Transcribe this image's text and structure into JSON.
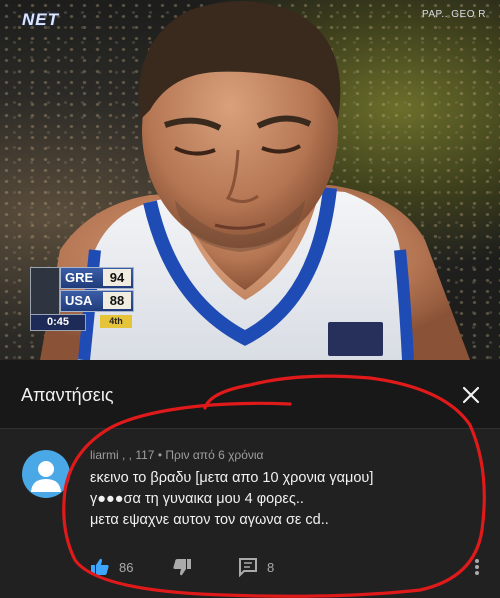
{
  "video": {
    "channel_logo": "NET",
    "watermark": "PAP.. GEO R",
    "scoreboard": {
      "team1": "GRE",
      "score1": "94",
      "team2": "USA",
      "score2": "88",
      "clock": "0:45",
      "period": "4th"
    }
  },
  "panel": {
    "title": "Απαντήσεις"
  },
  "comment": {
    "author": "liarmi , , 117",
    "separator": "•",
    "time": "Πριν από 6 χρόνια",
    "lines": [
      "εκεινο το βραδυ [μετα απο 10 χρονια γαμου]",
      "γ●●●σα τη γυναικα μου 4 φορες..",
      "μετα εψαχνε αυτον τον αγωνα σε cd.."
    ],
    "likes": "86",
    "replies": "8"
  },
  "colors": {
    "panel_bg": "#212121",
    "header_bg": "#181818",
    "text_primary": "#f1f1f1",
    "text_secondary": "#9e9e9e",
    "like_blue": "#3ea6ff",
    "avatar_blue": "#4aa8e6",
    "circle_red": "#e01a1a"
  },
  "icons": {
    "close": "close-icon",
    "like": "thumbs-up-icon",
    "dislike": "thumbs-down-icon",
    "reply": "comment-icon",
    "more": "more-vert-icon",
    "avatar": "default-avatar-icon"
  }
}
